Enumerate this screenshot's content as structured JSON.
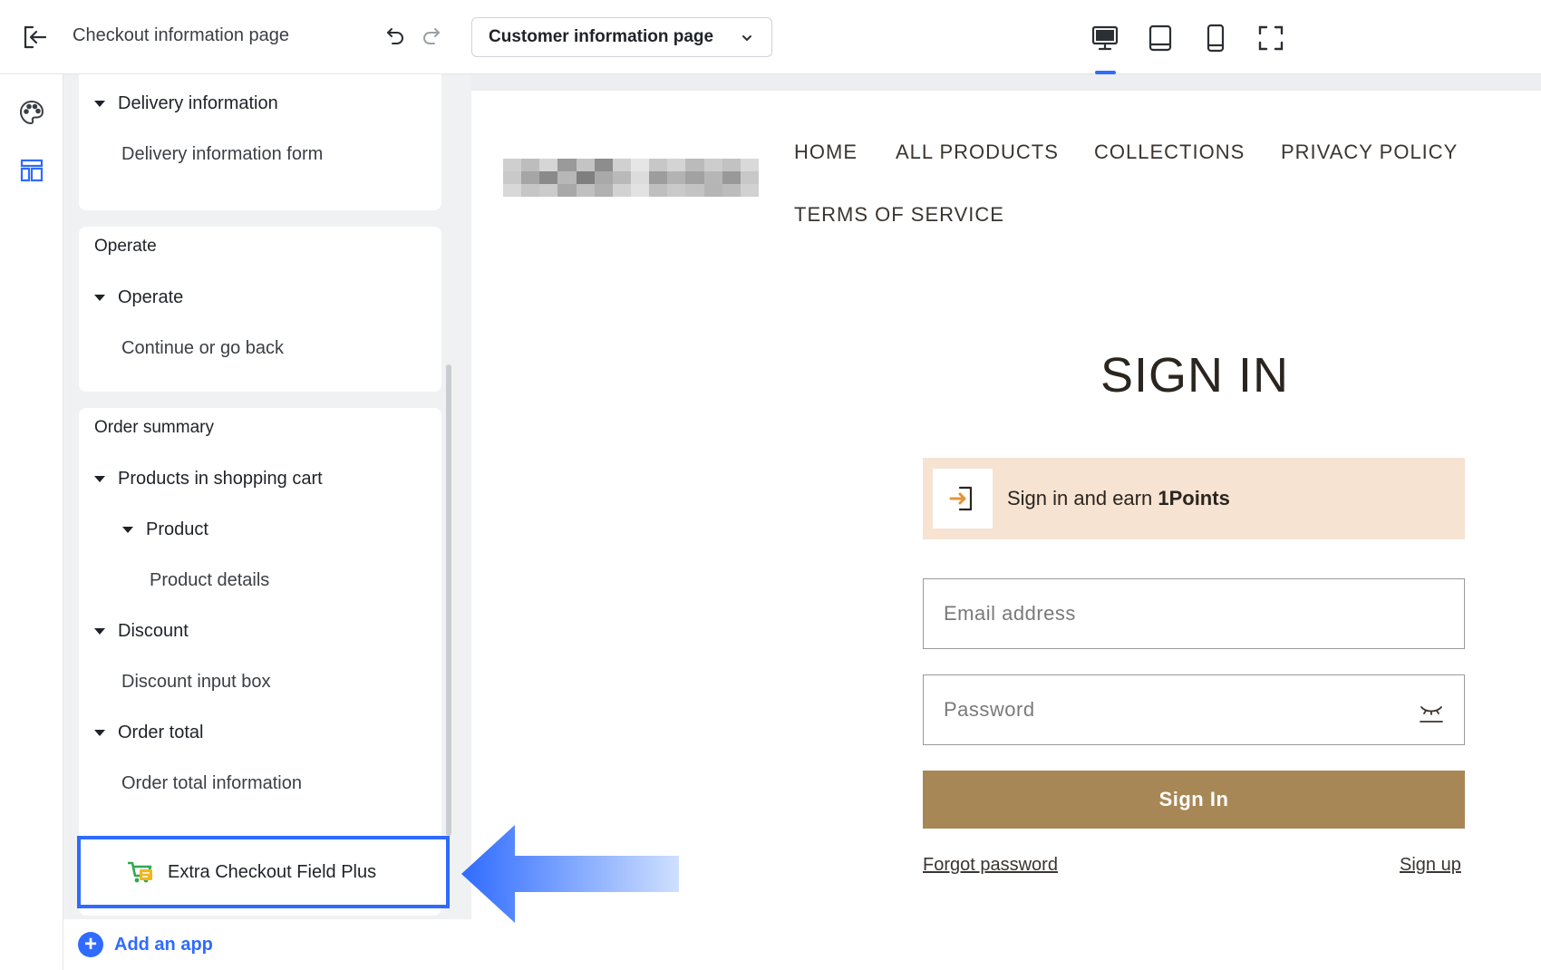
{
  "topbar": {
    "page_title": "Checkout information page",
    "page_select_value": "Customer information page"
  },
  "sidebar": {
    "card1": {
      "rows": [
        "Delivery information",
        "Delivery information form"
      ]
    },
    "card2": {
      "title": "Operate",
      "rows": [
        "Operate",
        "Continue or go back"
      ]
    },
    "card3": {
      "title": "Order summary",
      "rows": [
        "Products in shopping cart",
        "Product",
        "Product details",
        "Discount",
        "Discount input box",
        "Order total",
        "Order total information"
      ]
    },
    "app_row": "Extra Checkout Field Plus",
    "add_app": "Add an app"
  },
  "preview": {
    "nav": [
      "HOME",
      "ALL PRODUCTS",
      "COLLECTIONS",
      "PRIVACY POLICY",
      "TERMS OF SERVICE"
    ],
    "title": "SIGN IN",
    "promo_prefix": "Sign in and earn ",
    "promo_bold": "1Points",
    "email_placeholder": "Email address",
    "password_placeholder": "Password",
    "signin_button": "Sign In",
    "forgot_link": "Forgot password",
    "signup_link": "Sign up"
  },
  "colors": {
    "accent": "#2f6bff",
    "button_brown": "#a88757",
    "promo_bg": "#f6e3d2"
  }
}
